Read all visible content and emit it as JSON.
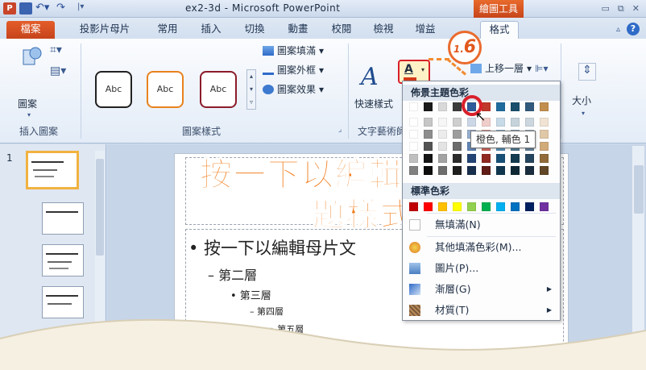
{
  "titlebar": {
    "title": "ex2-3d - Microsoft PowerPoint",
    "tools_tab": "繪圖工具",
    "app_icon": "P"
  },
  "tabs": {
    "file": "檔案",
    "items": [
      "投影片母片",
      "常用",
      "插入",
      "切換",
      "動畫",
      "校閱",
      "檢視",
      "增益",
      "格式"
    ]
  },
  "ribbon": {
    "insert_shapes": {
      "label": "插入圖案",
      "shapes_button": "圖案"
    },
    "shape_styles": {
      "label": "圖案樣式",
      "sample_text": "Abc",
      "fill": "圖案填滿",
      "outline": "圖案外框",
      "effects": "圖案效果"
    },
    "wordart": {
      "label": "文字藝術師",
      "quick_styles": "快速樣式"
    },
    "arrange": {
      "bring_forward": "上移一層"
    },
    "size": {
      "label": "大小"
    }
  },
  "step": {
    "prefix": "1.",
    "number": "6"
  },
  "dropdown": {
    "theme_header": "佈景主題色彩",
    "standard_header": "標準色彩",
    "theme_top_row": [
      "#ffffff",
      "#1a1a1a",
      "#d9d9d9",
      "#3b3b3b",
      "#2e5b9a",
      "#c0372b",
      "#1f6b9e",
      "#1b4f6b",
      "#315a7c",
      "#c18e4d"
    ],
    "standard_row": [
      "#c00000",
      "#ff0000",
      "#ffc000",
      "#ffff00",
      "#92d050",
      "#00b050",
      "#00b0f0",
      "#0070c0",
      "#002060",
      "#7030a0"
    ],
    "tooltip": "橙色, 輔色 1",
    "items": [
      {
        "label": "無填滿(N)",
        "icon": "no-fill-icon",
        "arrow": ""
      },
      {
        "label": "其他填滿色彩(M)...",
        "icon": "palette-icon",
        "arrow": ""
      },
      {
        "label": "圖片(P)...",
        "icon": "picture-icon",
        "arrow": ""
      },
      {
        "label": "漸層(G)",
        "icon": "gradient-icon",
        "arrow": "▶"
      },
      {
        "label": "材質(T)",
        "icon": "texture-icon",
        "arrow": "▶"
      }
    ]
  },
  "thumbs": {
    "first_number": "1"
  },
  "slide": {
    "title_line1": "按一下以編輯",
    "title_line2": "題樣式",
    "level1": "• 按一下以編輯母片文",
    "level2": "– 第二層",
    "level3": "• 第三層",
    "level4": "– 第四層",
    "level5": "» 第五層"
  }
}
